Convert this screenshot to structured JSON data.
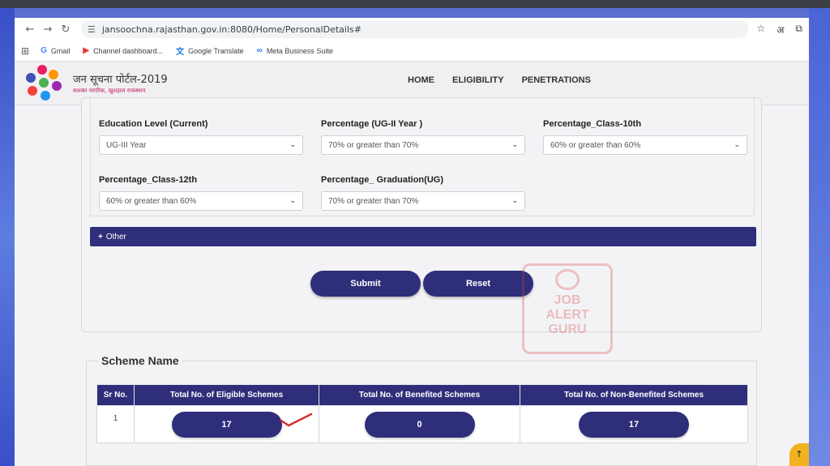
{
  "browser": {
    "url": "jansoochna.rajasthan.gov.in:8080/Home/PersonalDetails#",
    "lang_icon": "अ",
    "bookmarks": [
      {
        "icon": "google-icon",
        "label": "Gmail"
      },
      {
        "icon": "youtube-icon",
        "label": "Channel dashboard..."
      },
      {
        "icon": "translate-icon",
        "label": "Google Translate"
      },
      {
        "icon": "meta-icon",
        "label": "Meta Business Suite"
      }
    ]
  },
  "site": {
    "title": "जन सूचना पोर्टल-2019",
    "subtitle": "सशक्त नागरिक, खुशहाल राजस्थान",
    "nav": [
      "HOME",
      "ELIGIBILITY",
      "PENETRATIONS"
    ]
  },
  "form": {
    "fields": [
      {
        "label": "Education Level (Current)",
        "value": "UG-III Year"
      },
      {
        "label": "Percentage (UG-II Year )",
        "value": "70% or greater than 70%"
      },
      {
        "label": "Percentage_Class-10th",
        "value": "60% or greater than 60%"
      },
      {
        "label": "Percentage_Class-12th",
        "value": "60% or greater than 60%"
      },
      {
        "label": "Percentage_ Graduation(UG)",
        "value": "70% or greater than 70%"
      }
    ],
    "other_label": "Other",
    "submit_label": "Submit",
    "reset_label": "Reset"
  },
  "watermark": {
    "line1": "JOB",
    "line2": "ALERT",
    "line3": "GURU"
  },
  "scheme": {
    "title": "Scheme Name",
    "headers": [
      "Sr No.",
      "Total No. of Eligible Schemes",
      "Total No. of Benefited Schemes",
      "Total No. of Non-Benefited Schemes"
    ],
    "row": {
      "sr": "1",
      "eligible": "17",
      "benefited": "0",
      "non_benefited": "17"
    }
  },
  "colors": {
    "primary": "#2f2e7a",
    "tick": "#d32f2f",
    "accent": "#f0b21f"
  }
}
